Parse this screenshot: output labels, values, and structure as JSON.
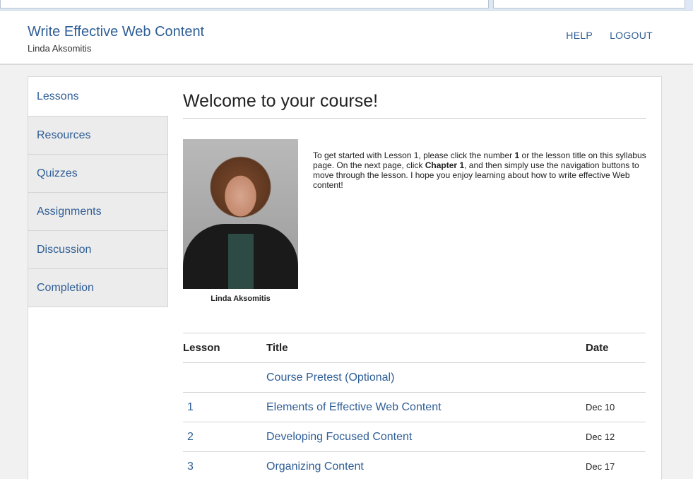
{
  "header": {
    "brand": "Write Effective Web Content",
    "user": "Linda Aksomitis",
    "help": "HELP",
    "logout": "LOGOUT"
  },
  "sidenav": {
    "items": [
      "Lessons",
      "Resources",
      "Quizzes",
      "Assignments",
      "Discussion",
      "Completion"
    ],
    "active": "Lessons"
  },
  "main": {
    "title": "Welcome to your course!",
    "photo_caption": "Linda Aksomitis",
    "intro_1": "To get started with Lesson 1, please click the number ",
    "intro_b1": "1",
    "intro_2": " or the lesson title on this syllabus page. On the next page, click ",
    "intro_b2": "Chapter 1",
    "intro_3": ", and then simply use the navigation buttons to move through the lesson. I hope you enjoy learning about how to write effective Web content!"
  },
  "table": {
    "headers": [
      "Lesson",
      "Title",
      "Date"
    ],
    "rows": [
      {
        "lesson": "",
        "title": "Course Pretest (Optional)",
        "date": ""
      },
      {
        "lesson": "1",
        "title": "Elements of Effective Web Content",
        "date": "Dec 10"
      },
      {
        "lesson": "2",
        "title": "Developing Focused Content",
        "date": "Dec 12"
      },
      {
        "lesson": "3",
        "title": "Organizing Content",
        "date": "Dec 17"
      }
    ]
  },
  "colors": {
    "link": "#2f5e96",
    "sidebar_bg": "#ececec",
    "page_bg": "#f1f1f1"
  }
}
